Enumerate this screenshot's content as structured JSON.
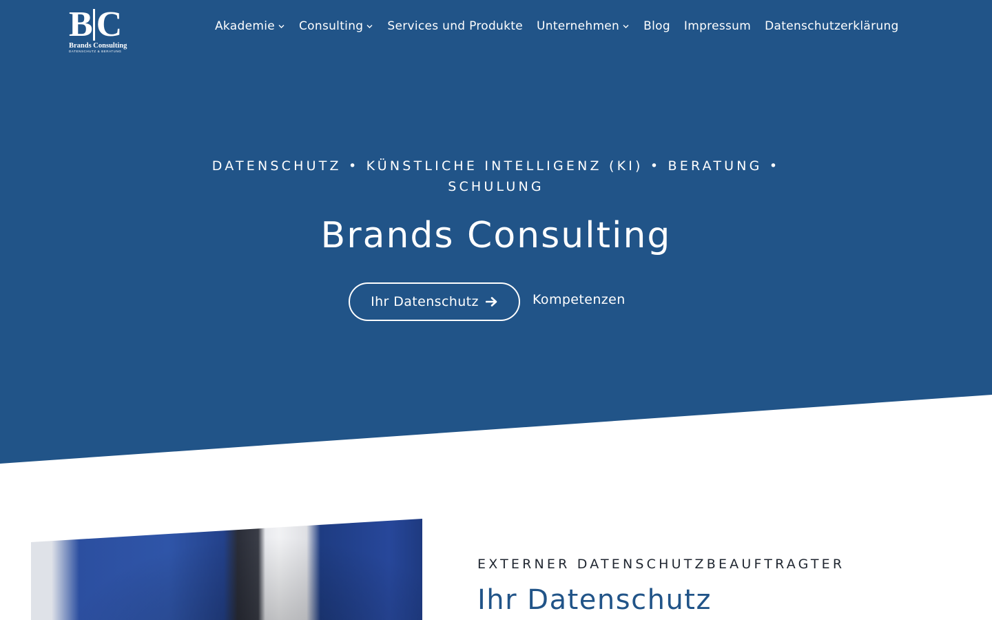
{
  "logo": {
    "mark": "BC",
    "name": "Brands Consulting",
    "tagline": "DATENSCHUTZ & BERATUNG"
  },
  "nav": {
    "items": [
      {
        "label": "Akademie",
        "has_dropdown": true
      },
      {
        "label": "Consulting",
        "has_dropdown": true
      },
      {
        "label": "Services und Produkte",
        "has_dropdown": false
      },
      {
        "label": "Unternehmen",
        "has_dropdown": true
      },
      {
        "label": "Blog",
        "has_dropdown": false
      },
      {
        "label": "Impressum",
        "has_dropdown": false
      },
      {
        "label": "Datenschutzerklärung",
        "has_dropdown": false
      }
    ]
  },
  "hero": {
    "kicker_line1": "DATENSCHUTZ • KÜNSTLICHE INTELLIGENZ (KI) • BERATUNG •",
    "kicker_line2": "SCHULUNG",
    "title": "Brands Consulting",
    "primary_button": "Ihr Datenschutz",
    "primary_button_icon": "arrow-right-icon",
    "secondary_button": "Kompetenzen"
  },
  "section": {
    "kicker": "EXTERNER DATENSCHUTZBEAUFTRAGTER",
    "title": "Ihr Datenschutz"
  },
  "colors": {
    "brand_blue": "#215488",
    "text_dark": "#1f2630",
    "white": "#ffffff"
  }
}
